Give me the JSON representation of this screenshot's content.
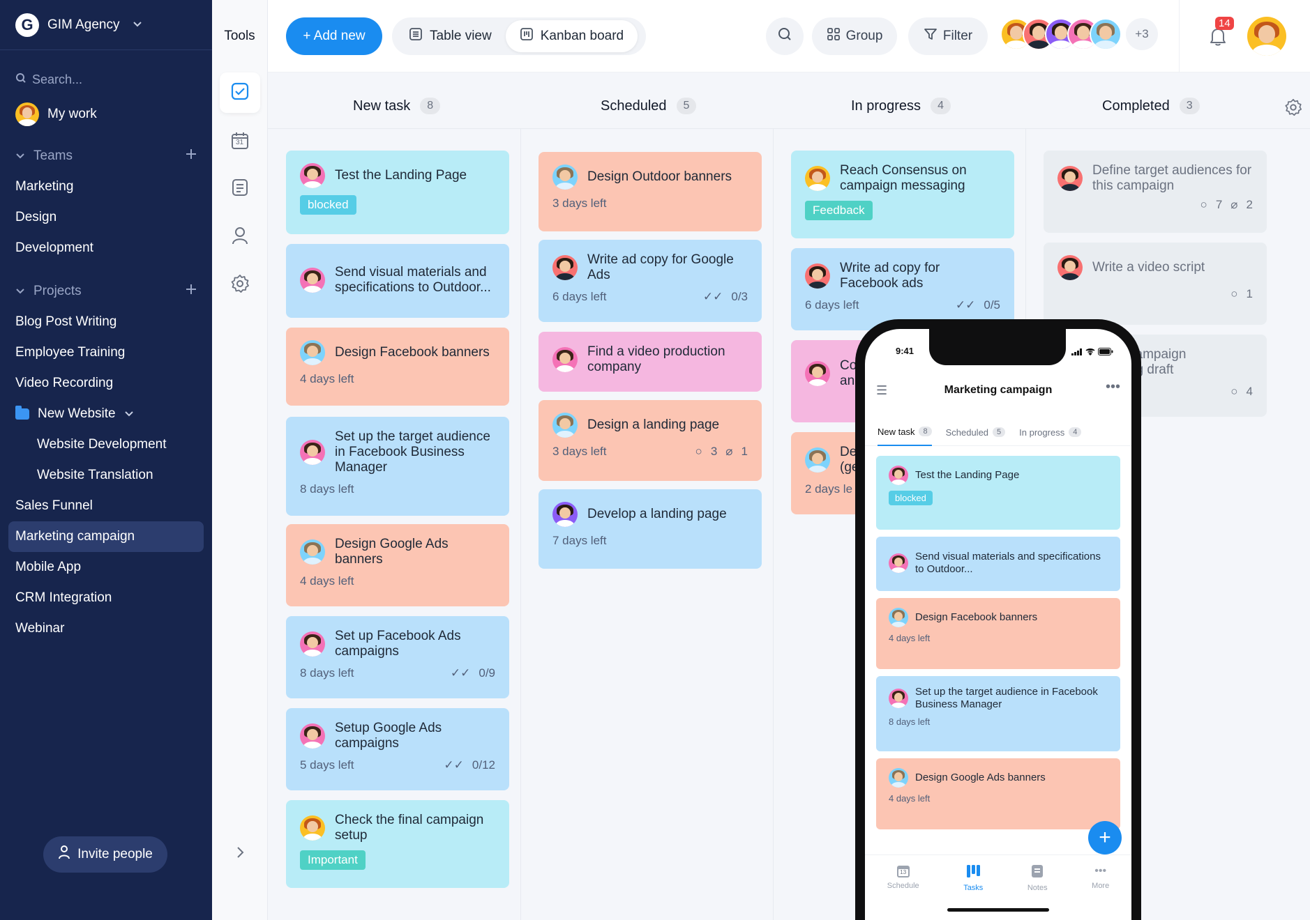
{
  "workspace": {
    "name": "GIM Agency"
  },
  "sidebar": {
    "search_placeholder": "Search...",
    "my_work": "My work",
    "teams_label": "Teams",
    "teams": [
      "Marketing",
      "Design",
      "Development"
    ],
    "projects_label": "Projects",
    "projects": [
      "Blog Post Writing",
      "Employee Training",
      "Video Recording"
    ],
    "folder": {
      "label": "New Website",
      "children": [
        "Website Development",
        "Website Translation"
      ]
    },
    "projects_after": [
      "Sales Funnel",
      "Marketing campaign",
      "Mobile App",
      "CRM Integration",
      "Webinar"
    ],
    "active_item": "Marketing campaign",
    "invite_label": "Invite people"
  },
  "tools": {
    "title": "Tools",
    "calendar_day": "31"
  },
  "topbar": {
    "add_new": "+ Add new",
    "table_view": "Table view",
    "kanban_board": "Kanban board",
    "group": "Group",
    "filter": "Filter",
    "more_members": "+3",
    "notification_count": "14"
  },
  "board": {
    "columns": [
      {
        "title": "New task",
        "count": "8"
      },
      {
        "title": "Scheduled",
        "count": "5"
      },
      {
        "title": "In progress",
        "count": "4"
      },
      {
        "title": "Completed",
        "count": "3"
      }
    ],
    "new_task": [
      {
        "title": "Test the Landing Page",
        "tag": "blocked",
        "color": "#b8ecf7"
      },
      {
        "title": "Send visual materials and specifications to Outdoor...",
        "color": "#b9e0fb"
      },
      {
        "title": "Design Facebook banners",
        "due": "4 days left",
        "color": "#fcc5b3"
      },
      {
        "title": "Set up the target audience in Facebook Business Manager",
        "due": "8 days left",
        "color": "#b9e0fb"
      },
      {
        "title": "Design Google Ads banners",
        "due": "4 days left",
        "color": "#fcc5b3"
      },
      {
        "title": "Set up Facebook Ads campaigns",
        "due": "8 days left",
        "checklist": "0/9",
        "color": "#b9e0fb"
      },
      {
        "title": "Setup Google Ads campaigns",
        "due": "5 days left",
        "checklist": "0/12",
        "color": "#b9e0fb"
      },
      {
        "title": "Check the final campaign setup",
        "tag": "Important",
        "color": "#b8ecf7"
      }
    ],
    "scheduled": [
      {
        "title": "Design Outdoor banners",
        "due": "3 days left",
        "color": "#fcc5b3"
      },
      {
        "title": "Write ad copy for Google Ads",
        "due": "6 days left",
        "checklist": "0/3",
        "color": "#b9e0fb"
      },
      {
        "title": "Find a video production company",
        "color": "#f5b7e0"
      },
      {
        "title": "Design a landing page",
        "due": "3 days left",
        "comments": "3",
        "attachments": "1",
        "color": "#fcc5b3"
      },
      {
        "title": "Develop a landing page",
        "due": "7 days left",
        "color": "#b9e0fb"
      }
    ],
    "in_progress": [
      {
        "title": "Reach Consensus on campaign messaging",
        "tag": "Feedback",
        "color": "#b8ecf7"
      },
      {
        "title": "Write ad copy for Facebook ads",
        "due": "6 days left",
        "checklist": "0/5",
        "color": "#b9e0fb"
      },
      {
        "title": "Co",
        "title2": "anc",
        "color": "#f5b7e0"
      },
      {
        "title": "De",
        "title2": "(ge",
        "due": "2 days le",
        "color": "#fcc5b3"
      }
    ],
    "completed": [
      {
        "title": "Define target audiences for this campaign",
        "comments": "7",
        "attachments": "2"
      },
      {
        "title": "Write a video script",
        "comments": "1"
      },
      {
        "title": "campaign",
        "title2": "ng draft",
        "comments": "4"
      }
    ]
  },
  "phone": {
    "time": "9:41",
    "title": "Marketing campaign",
    "tabs": [
      {
        "label": "New task",
        "count": "8"
      },
      {
        "label": "Scheduled",
        "count": "5"
      },
      {
        "label": "In progress",
        "count": "4"
      }
    ],
    "cards": [
      {
        "title": "Test the Landing Page",
        "tag": "blocked",
        "color": "#b8ecf7"
      },
      {
        "title": "Send visual materials and specifications to Outdoor...",
        "color": "#b9e0fb"
      },
      {
        "title": "Design Facebook banners",
        "due": "4 days left",
        "color": "#fcc5b3"
      },
      {
        "title": "Set up the target audience in Facebook Business Manager",
        "due": "8 days left",
        "color": "#b9e0fb"
      },
      {
        "title": "Design Google Ads banners",
        "due": "4 days left",
        "color": "#fcc5b3"
      }
    ],
    "nav": [
      "Schedule",
      "Tasks",
      "Notes",
      "More"
    ],
    "schedule_day": "13"
  }
}
